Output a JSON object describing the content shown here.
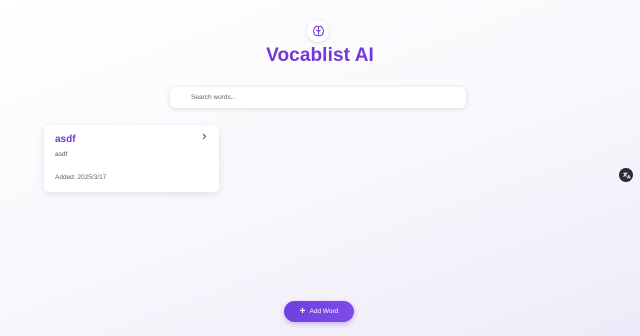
{
  "app": {
    "title": "Vocablist AI",
    "logo_icon": "brain-icon",
    "accent_color": "#7438d9"
  },
  "search": {
    "placeholder": "Search words...",
    "value": ""
  },
  "words": [
    {
      "word": "asdf",
      "definition": "asdf",
      "added_label": "Added: 2025/3/17"
    }
  ],
  "add_button": {
    "icon": "plus-icon",
    "label": "Add Word"
  },
  "side_button": {
    "icon": "translate-icon"
  }
}
